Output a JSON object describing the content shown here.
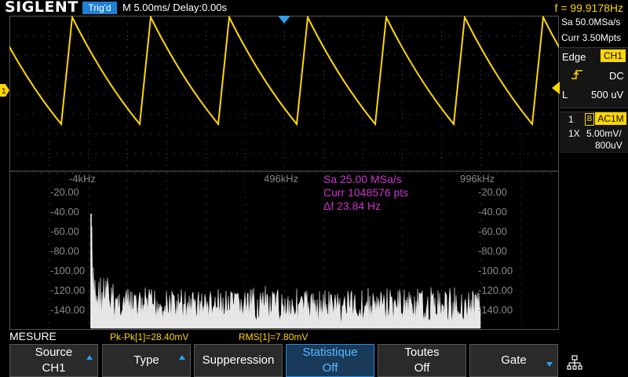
{
  "header": {
    "brand": "SIGLENT",
    "trigger_status": "Trig'd",
    "timebase": "M 5.00ms/ Delay:0.00s",
    "frequency": "f = 99.9178Hz"
  },
  "acquisition": {
    "sample_rate": "Sa 50.0MSa/s",
    "memory": "Curr 3.50Mpts"
  },
  "trigger": {
    "type": "Edge",
    "source": "CH1",
    "coupling": "DC",
    "level_label": "L",
    "level": "500 uV"
  },
  "channel": {
    "number": "1",
    "bandwidth_badge": "B",
    "coupling": "AC1M",
    "probe": "1X",
    "scale": "5.00mV/",
    "offset": "800uV"
  },
  "fft": {
    "freq_left": "-4kHz",
    "freq_mid": "496kHz",
    "freq_right": "996kHz",
    "sample_rate": "Sa 25.00 MSa/s",
    "points": "Curr 1048576 pts",
    "delta_f": "Δf 23.84 Hz",
    "db_labels": [
      "-20.00",
      "-40.00",
      "-60.00",
      "-80.00",
      "-100.00",
      "-120.00",
      "-140.00"
    ]
  },
  "measurements": {
    "title": "MESURE",
    "pkpk": "Pk-Pk[1]=28.40mV",
    "rms": "RMS[1]=7.80mV"
  },
  "menu": [
    {
      "line1": "Source",
      "line2": "CH1",
      "arrow": "up"
    },
    {
      "line1": "Type",
      "line2": "",
      "arrow": "up"
    },
    {
      "line1": "Supperession",
      "line2": "",
      "arrow": ""
    },
    {
      "line1": "Statistique",
      "line2": "Off",
      "arrow": "",
      "active": true
    },
    {
      "line1": "Toutes",
      "line2": "Off",
      "arrow": ""
    },
    {
      "line1": "Gate",
      "line2": "",
      "arrow": "down"
    }
  ],
  "colors": {
    "ch1": "#ffd700",
    "accent": "#1e7fd3",
    "fft_text": "#cc33cc",
    "grid": "#3a3a3a"
  }
}
